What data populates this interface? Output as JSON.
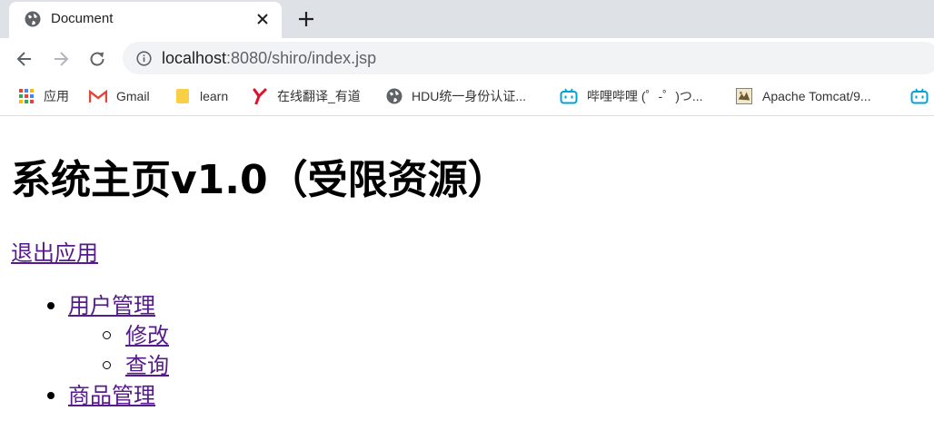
{
  "browser": {
    "tab": {
      "title": "Document"
    },
    "address": {
      "host": "localhost",
      "path": ":8080/shiro/index.jsp"
    },
    "bookmarks": [
      {
        "label": "应用",
        "icon": "apps-grid-icon"
      },
      {
        "label": "Gmail",
        "icon": "gmail-icon"
      },
      {
        "label": "learn",
        "icon": "folder-icon"
      },
      {
        "label": "在线翻译_有道",
        "icon": "youdao-icon"
      },
      {
        "label": "HDU统一身份认证...",
        "icon": "globe-icon"
      },
      {
        "label": "哔哩哔哩 (゜-゜)つ...",
        "icon": "bilibili-icon"
      },
      {
        "label": "Apache Tomcat/9...",
        "icon": "tomcat-icon"
      }
    ]
  },
  "page": {
    "title": "系统主页v1.0（受限资源）",
    "logout": "退出应用",
    "menu": [
      {
        "label": "用户管理",
        "children": [
          "修改",
          "查询"
        ]
      },
      {
        "label": "商品管理"
      }
    ]
  },
  "colors": {
    "link_visited": "#551a8b",
    "tabstrip": "#dee1e6",
    "omnibox": "#f1f3f4"
  }
}
